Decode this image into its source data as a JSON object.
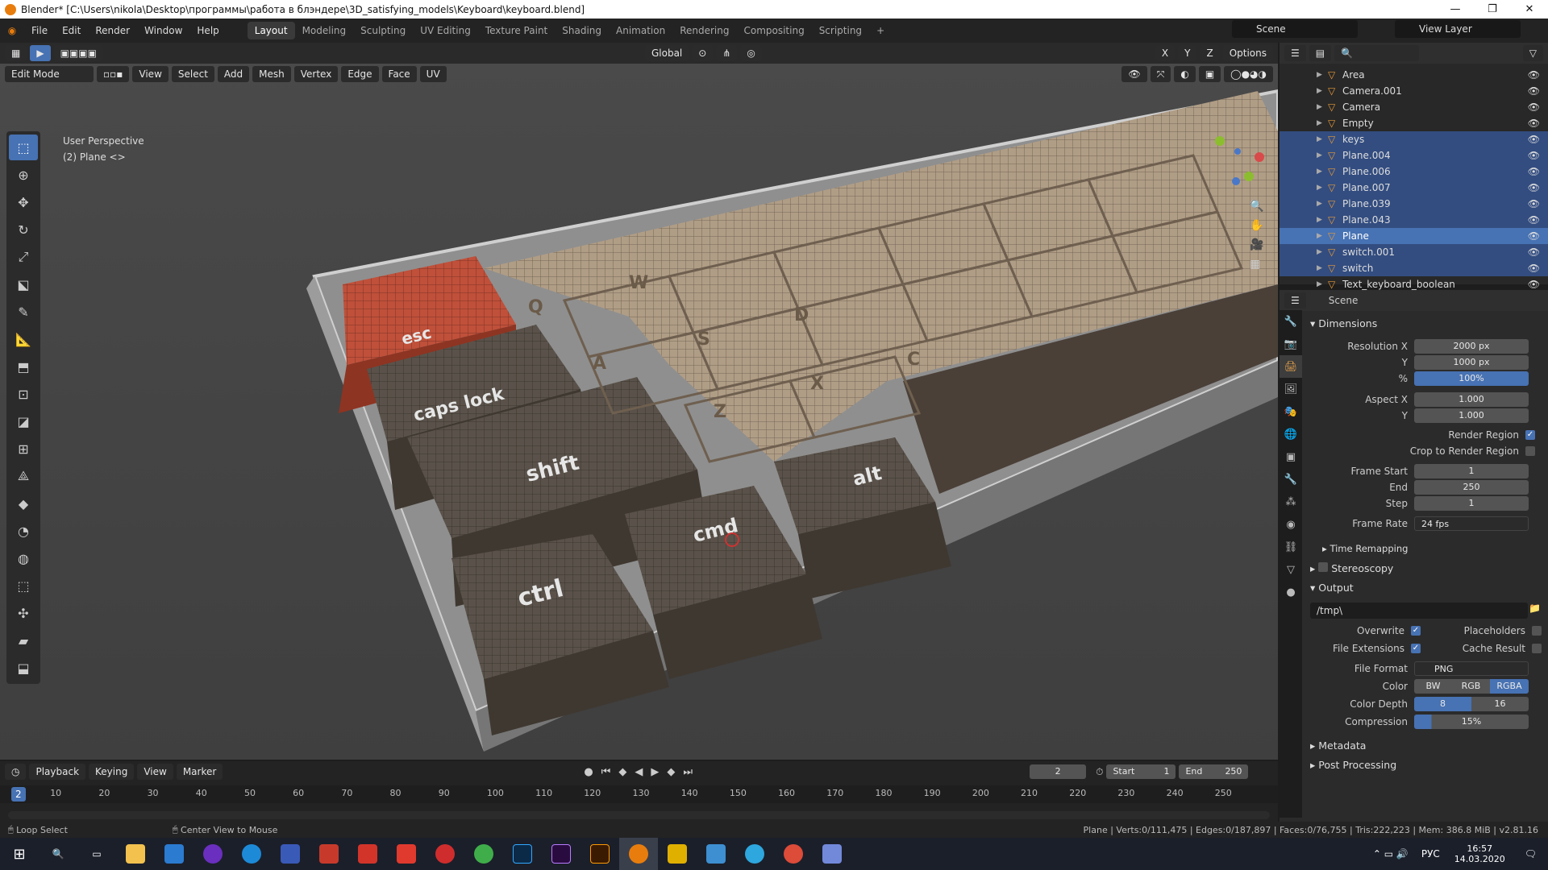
{
  "window": {
    "title": "Blender* [C:\\Users\\nikola\\Desktop\\программы\\работа в блэндере\\3D_satisfying_models\\Keyboard\\keyboard.blend]",
    "controls": [
      "—",
      "❐",
      "✕"
    ]
  },
  "menu": {
    "items": [
      "File",
      "Edit",
      "Render",
      "Window",
      "Help"
    ]
  },
  "workspaces": [
    "Layout",
    "Modeling",
    "Sculpting",
    "UV Editing",
    "Texture Paint",
    "Shading",
    "Animation",
    "Rendering",
    "Compositing",
    "Scripting",
    "+"
  ],
  "scene": {
    "name": "Scene",
    "view_layer": "View Layer"
  },
  "viewport": {
    "transform_orientation": "Global",
    "options": "Options",
    "axes": [
      "X",
      "Y",
      "Z"
    ],
    "mode": "Edit Mode",
    "header_menus": [
      "View",
      "Select",
      "Add",
      "Mesh",
      "Vertex",
      "Edge",
      "Face",
      "UV"
    ],
    "perspective": "User Perspective",
    "object_info": "(2) Plane <>"
  },
  "keys": {
    "esc": "esc",
    "caps": "caps lock",
    "shift": "shift",
    "ctrl": "ctrl",
    "cmd": "cmd",
    "alt": "alt",
    "q": "Q",
    "w": "W",
    "a": "A",
    "s": "S",
    "d": "D",
    "z": "Z",
    "x": "X",
    "c": "C"
  },
  "outliner": {
    "items": [
      {
        "name": "Area",
        "state": "normal"
      },
      {
        "name": "Camera.001",
        "state": "normal"
      },
      {
        "name": "Camera",
        "state": "normal"
      },
      {
        "name": "Empty",
        "state": "normal"
      },
      {
        "name": "keys",
        "state": "selected"
      },
      {
        "name": "Plane.004",
        "state": "selected"
      },
      {
        "name": "Plane.006",
        "state": "selected"
      },
      {
        "name": "Plane.007",
        "state": "selected"
      },
      {
        "name": "Plane.039",
        "state": "selected"
      },
      {
        "name": "Plane.043",
        "state": "selected"
      },
      {
        "name": "Plane",
        "state": "active"
      },
      {
        "name": "switch.001",
        "state": "selected"
      },
      {
        "name": "switch",
        "state": "selected"
      },
      {
        "name": "Text_keyboard_boolean",
        "state": "normal"
      }
    ]
  },
  "props": {
    "header": "Scene",
    "dimensions": "Dimensions",
    "res_x_label": "Resolution X",
    "res_x": "2000 px",
    "res_y_label": "Y",
    "res_y": "1000 px",
    "pct_label": "%",
    "pct": "100%",
    "aspect_x_label": "Aspect X",
    "aspect_x": "1.000",
    "aspect_y_label": "Y",
    "aspect_y": "1.000",
    "render_region": "Render Region",
    "crop": "Crop to Render Region",
    "frame_start_label": "Frame Start",
    "frame_start": "1",
    "end_label": "End",
    "end": "250",
    "step_label": "Step",
    "step": "1",
    "frame_rate_label": "Frame Rate",
    "frame_rate": "24 fps",
    "time_remapping": "Time Remapping",
    "stereoscopy": "Stereoscopy",
    "output": "Output",
    "path": "/tmp\\",
    "overwrite": "Overwrite",
    "placeholders": "Placeholders",
    "file_ext": "File Extensions",
    "cache": "Cache Result",
    "file_format_label": "File Format",
    "file_format": "PNG",
    "color_label": "Color",
    "color_opts": [
      "BW",
      "RGB",
      "RGBA"
    ],
    "depth_label": "Color Depth",
    "depth_opts": [
      "8",
      "16"
    ],
    "compression_label": "Compression",
    "compression": "15%",
    "metadata": "Metadata",
    "post": "Post Processing"
  },
  "timeline": {
    "menus": [
      "Playback",
      "Keying",
      "View",
      "Marker"
    ],
    "current": "2",
    "start_label": "Start",
    "start": "1",
    "end_label": "End",
    "end": "250",
    "ticks": [
      "10",
      "20",
      "30",
      "40",
      "50",
      "60",
      "70",
      "80",
      "90",
      "100",
      "110",
      "120",
      "130",
      "140",
      "150",
      "160",
      "170",
      "180",
      "190",
      "200",
      "210",
      "220",
      "230",
      "240",
      "250"
    ],
    "playhead": "2"
  },
  "status": {
    "left": "Loop Select",
    "mid": "Center View to Mouse",
    "right": "Plane | Verts:0/111,475 | Edges:0/187,897 | Faces:0/76,755 | Tris:222,223 | Mem: 386.8 MiB | v2.81.16"
  },
  "taskbar": {
    "lang": "РУС",
    "time": "16:57",
    "date": "14.03.2020"
  },
  "colors": {
    "accent": "#4772b3",
    "esc_key": "#b84a2c",
    "dark_key": "#4d443a",
    "light_key": "#b8a58f"
  }
}
